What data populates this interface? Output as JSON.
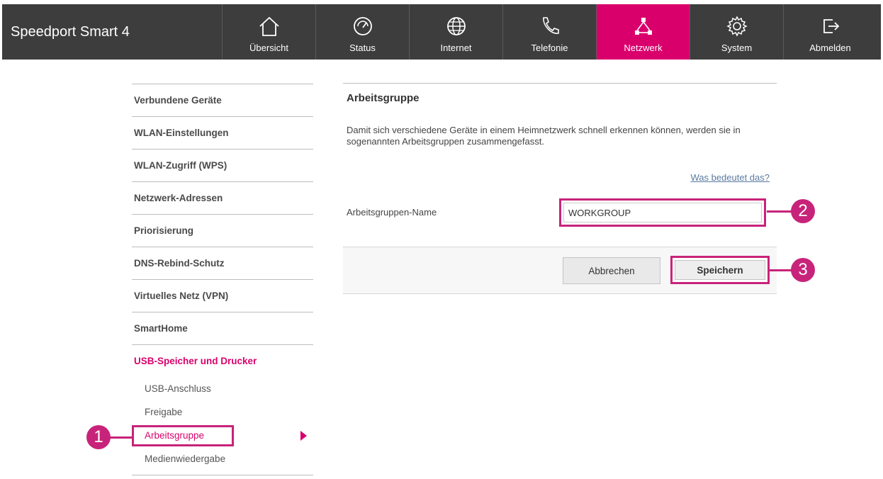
{
  "brand": "Speedport Smart 4",
  "nav": [
    {
      "label": "Übersicht",
      "icon": "home-icon"
    },
    {
      "label": "Status",
      "icon": "gauge-icon"
    },
    {
      "label": "Internet",
      "icon": "globe-icon"
    },
    {
      "label": "Telefonie",
      "icon": "phone-icon"
    },
    {
      "label": "Netzwerk",
      "icon": "network-icon",
      "active": true
    },
    {
      "label": "System",
      "icon": "gear-icon"
    },
    {
      "label": "Abmelden",
      "icon": "logout-icon"
    }
  ],
  "sidebar": {
    "items": [
      "Verbundene Geräte",
      "WLAN-Einstellungen",
      "WLAN-Zugriff (WPS)",
      "Netzwerk-Adressen",
      "Priorisierung",
      "DNS-Rebind-Schutz",
      "Virtuelles Netz (VPN)",
      "SmartHome",
      "USB-Speicher und Drucker"
    ],
    "subitems": [
      "USB-Anschluss",
      "Freigabe",
      "Arbeitsgruppe",
      "Medienwiedergabe"
    ]
  },
  "panel": {
    "title": "Arbeitsgruppe",
    "description": "Damit sich verschiedene Geräte in einem Heimnetzwerk schnell erkennen können, werden sie in sogenannten Arbeitsgruppen zusammengefasst.",
    "help_link": "Was bedeutet das?",
    "field_label": "Arbeitsgruppen-Name",
    "field_value": "WORKGROUP",
    "cancel_label": "Abbrechen",
    "save_label": "Speichern"
  },
  "callouts": [
    "1",
    "2",
    "3"
  ],
  "colors": {
    "accent": "#d9006c",
    "topbar": "#3d3d3d",
    "callout": "#c8237a"
  }
}
